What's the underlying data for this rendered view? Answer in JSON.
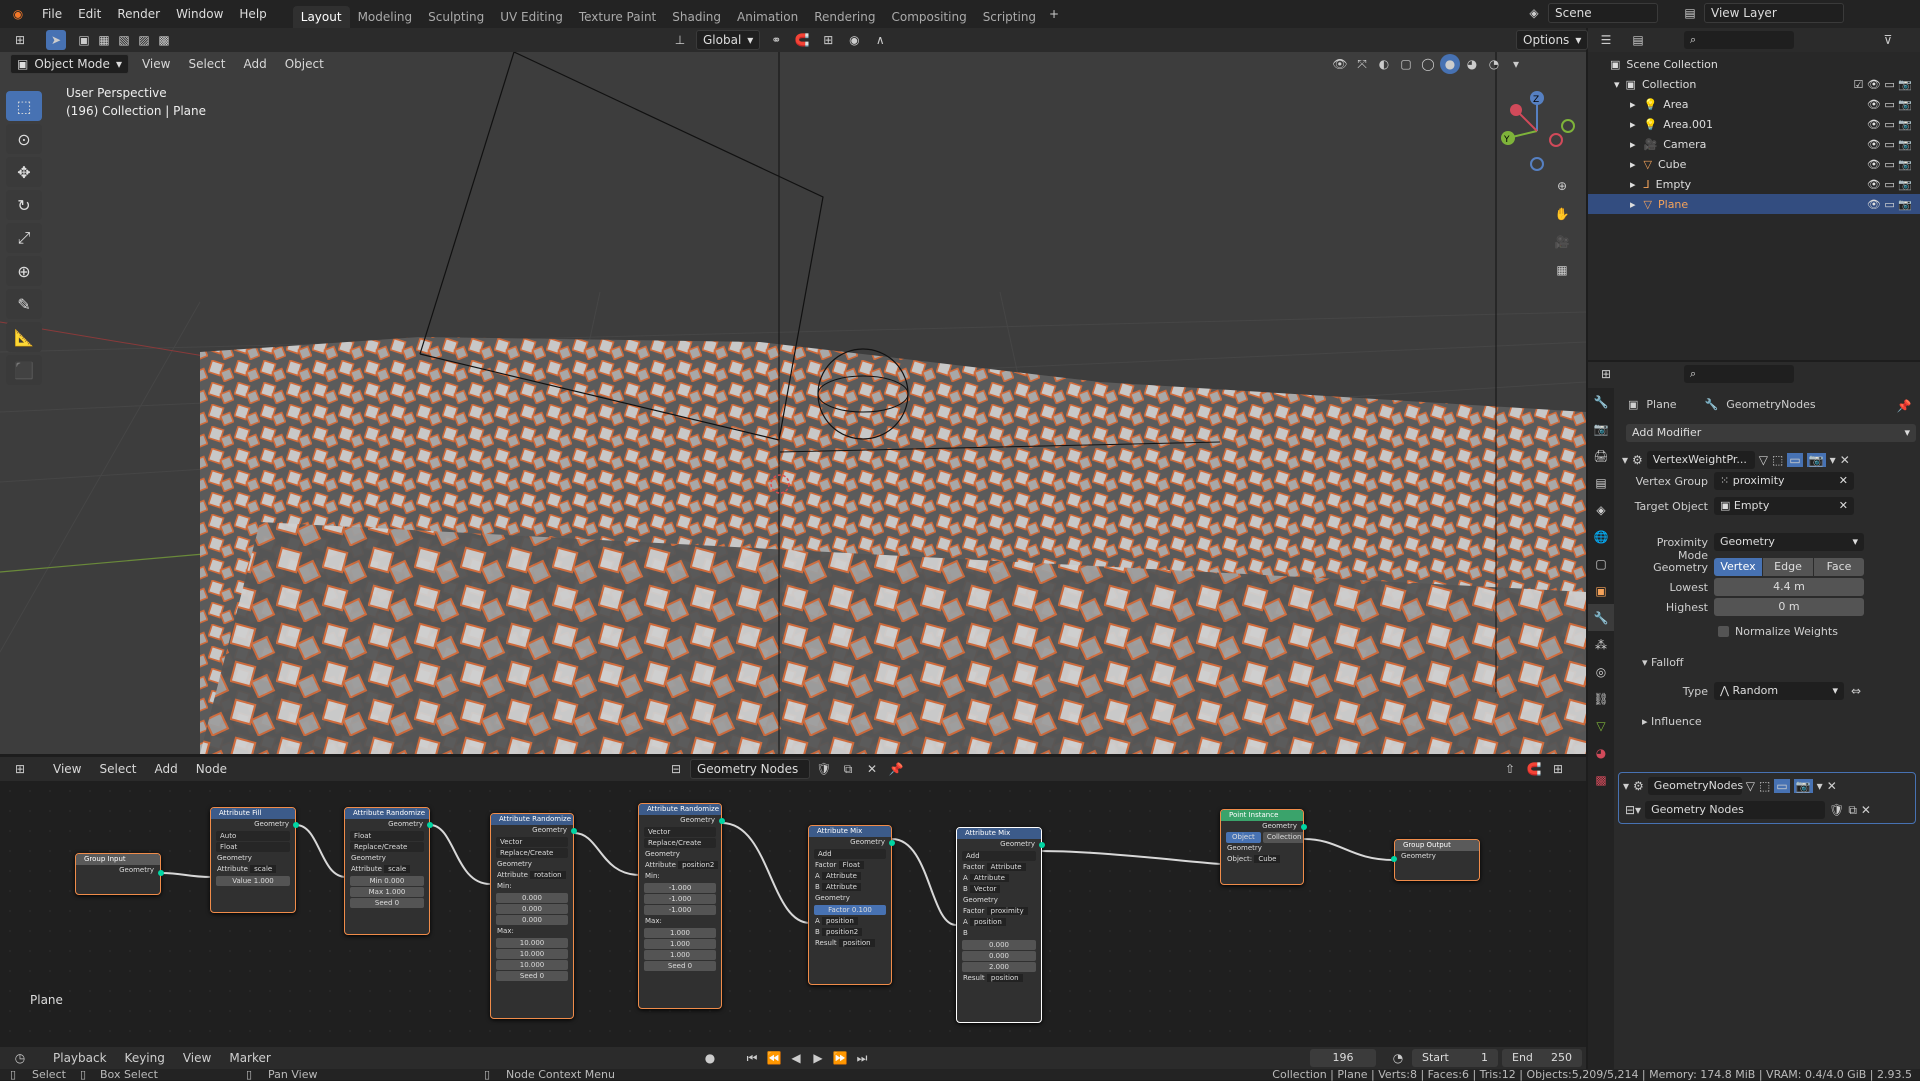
{
  "topbar": {
    "menus": [
      "File",
      "Edit",
      "Render",
      "Window",
      "Help"
    ],
    "workspaces": [
      "Layout",
      "Modeling",
      "Sculpting",
      "UV Editing",
      "Texture Paint",
      "Shading",
      "Animation",
      "Rendering",
      "Compositing",
      "Scripting"
    ],
    "active_workspace": "Layout",
    "scene": "Scene",
    "view_layer": "View Layer"
  },
  "viewport_header": {
    "mode": "Object Mode",
    "menus": [
      "View",
      "Select",
      "Add",
      "Object"
    ],
    "orientation": "Global",
    "options": "Options"
  },
  "viewport": {
    "perspective": "User Perspective",
    "collection_info": "(196) Collection | Plane"
  },
  "node_header": {
    "menus": [
      "View",
      "Select",
      "Add",
      "Node"
    ],
    "tree_name": "Geometry Nodes"
  },
  "nodes": {
    "group_input": {
      "title": "Group Input",
      "out": "Geometry"
    },
    "attr_fill": {
      "title": "Attribute Fill",
      "out": "Geometry",
      "d1": "Auto",
      "d2": "Float",
      "in": "Geometry",
      "attr_label": "Attribute",
      "attr_val": "scale",
      "value_label": "Value",
      "value": "1.000"
    },
    "attr_rand1": {
      "title": "Attribute Randomize",
      "out": "Geometry",
      "d1": "Float",
      "d2": "Replace/Create",
      "in": "Geometry",
      "attr_label": "Attribute",
      "attr_val": "scale",
      "min_label": "Min",
      "min": "0.000",
      "max_label": "Max",
      "max": "1.000",
      "seed_label": "Seed",
      "seed": "0"
    },
    "attr_rand2": {
      "title": "Attribute Randomize",
      "out": "Geometry",
      "d1": "Vector",
      "d2": "Replace/Create",
      "in": "Geometry",
      "attr_label": "Attribute",
      "attr_val": "rotation",
      "min_label": "Min:",
      "min": [
        "0.000",
        "0.000",
        "0.000"
      ],
      "max_label": "Max:",
      "max": [
        "10.000",
        "10.000",
        "10.000"
      ],
      "seed_label": "Seed",
      "seed": "0"
    },
    "attr_rand3": {
      "title": "Attribute Randomize",
      "out": "Geometry",
      "d1": "Vector",
      "d2": "Replace/Create",
      "in": "Geometry",
      "attr_label": "Attribute",
      "attr_val": "position2",
      "min_label": "Min:",
      "min": [
        "-1.000",
        "-1.000",
        "-1.000"
      ],
      "max_label": "Max:",
      "max": [
        "1.000",
        "1.000",
        "1.000"
      ],
      "seed_label": "Seed",
      "seed": "0"
    },
    "attr_mix1": {
      "title": "Attribute Mix",
      "out": "Geometry",
      "d1": "Add",
      "factor_label": "Factor",
      "factor_type": "Float",
      "a_label": "A",
      "a_type": "Attribute",
      "b_label": "B",
      "b_type": "Attribute",
      "in": "Geometry",
      "f_label": "Factor",
      "f_val": "0.100",
      "a2_label": "A",
      "a2": "position",
      "b2_label": "B",
      "b2": "position2",
      "res_label": "Result",
      "res": "position"
    },
    "attr_mix2": {
      "title": "Attribute Mix",
      "out": "Geometry",
      "d1": "Add",
      "factor_label": "Factor",
      "factor_type": "Attribute",
      "a_label": "A",
      "a_type": "Attribute",
      "b_label": "B",
      "b_type": "Vector",
      "in": "Geometry",
      "f_label": "Factor",
      "f_val": "proximity",
      "a2_label": "A",
      "a2": "position",
      "b2_label": "B",
      "bvals": [
        "0.000",
        "0.000",
        "2.000"
      ],
      "res_label": "Result",
      "res": "position"
    },
    "point_instance": {
      "title": "Point Instance",
      "out": "Geometry",
      "opt1": "Object",
      "opt2": "Collection",
      "in": "Geometry",
      "obj_label": "Object:",
      "obj": "Cube"
    },
    "group_output": {
      "title": "Group Output",
      "in": "Geometry"
    }
  },
  "node_editor_label": "Plane",
  "timeline": {
    "menus": [
      "Playback",
      "Keying",
      "View",
      "Marker"
    ],
    "frame": "196",
    "start_label": "Start",
    "start": "1",
    "end_label": "End",
    "end": "250"
  },
  "statusbar": {
    "select": "Select",
    "box_select": "Box Select",
    "pan_view": "Pan View",
    "node_context": "Node Context Menu",
    "stats": "Collection | Plane | Verts:8 | Faces:6 | Tris:12 | Objects:5,209/5,214 | Memory: 174.8 MiB | VRAM: 0.4/4.0 GiB | 2.93.5"
  },
  "outliner": {
    "scene_collection": "Scene Collection",
    "collection": "Collection",
    "items": [
      "Area",
      "Area.001",
      "Camera",
      "Cube",
      "Empty",
      "Plane"
    ],
    "selected": "Plane"
  },
  "properties": {
    "object": "Plane",
    "modifier_breadcrumb": "GeometryNodes",
    "add_modifier": "Add Modifier",
    "mod1_name": "VertexWeightPr...",
    "vertex_group_label": "Vertex Group",
    "vertex_group": "proximity",
    "target_object_label": "Target Object",
    "target_object": "Empty",
    "proximity_mode_label": "Proximity Mode",
    "proximity_mode": "Geometry",
    "geometry_label": "Geometry",
    "geom_opts": [
      "Vertex",
      "Edge",
      "Face"
    ],
    "lowest_label": "Lowest",
    "lowest": "4.4 m",
    "highest_label": "Highest",
    "highest": "0 m",
    "normalize": "Normalize Weights",
    "falloff": "Falloff",
    "type_label": "Type",
    "type": "Random",
    "influence": "Influence",
    "mod2_name": "GeometryNodes",
    "node_group": "Geometry Nodes"
  }
}
